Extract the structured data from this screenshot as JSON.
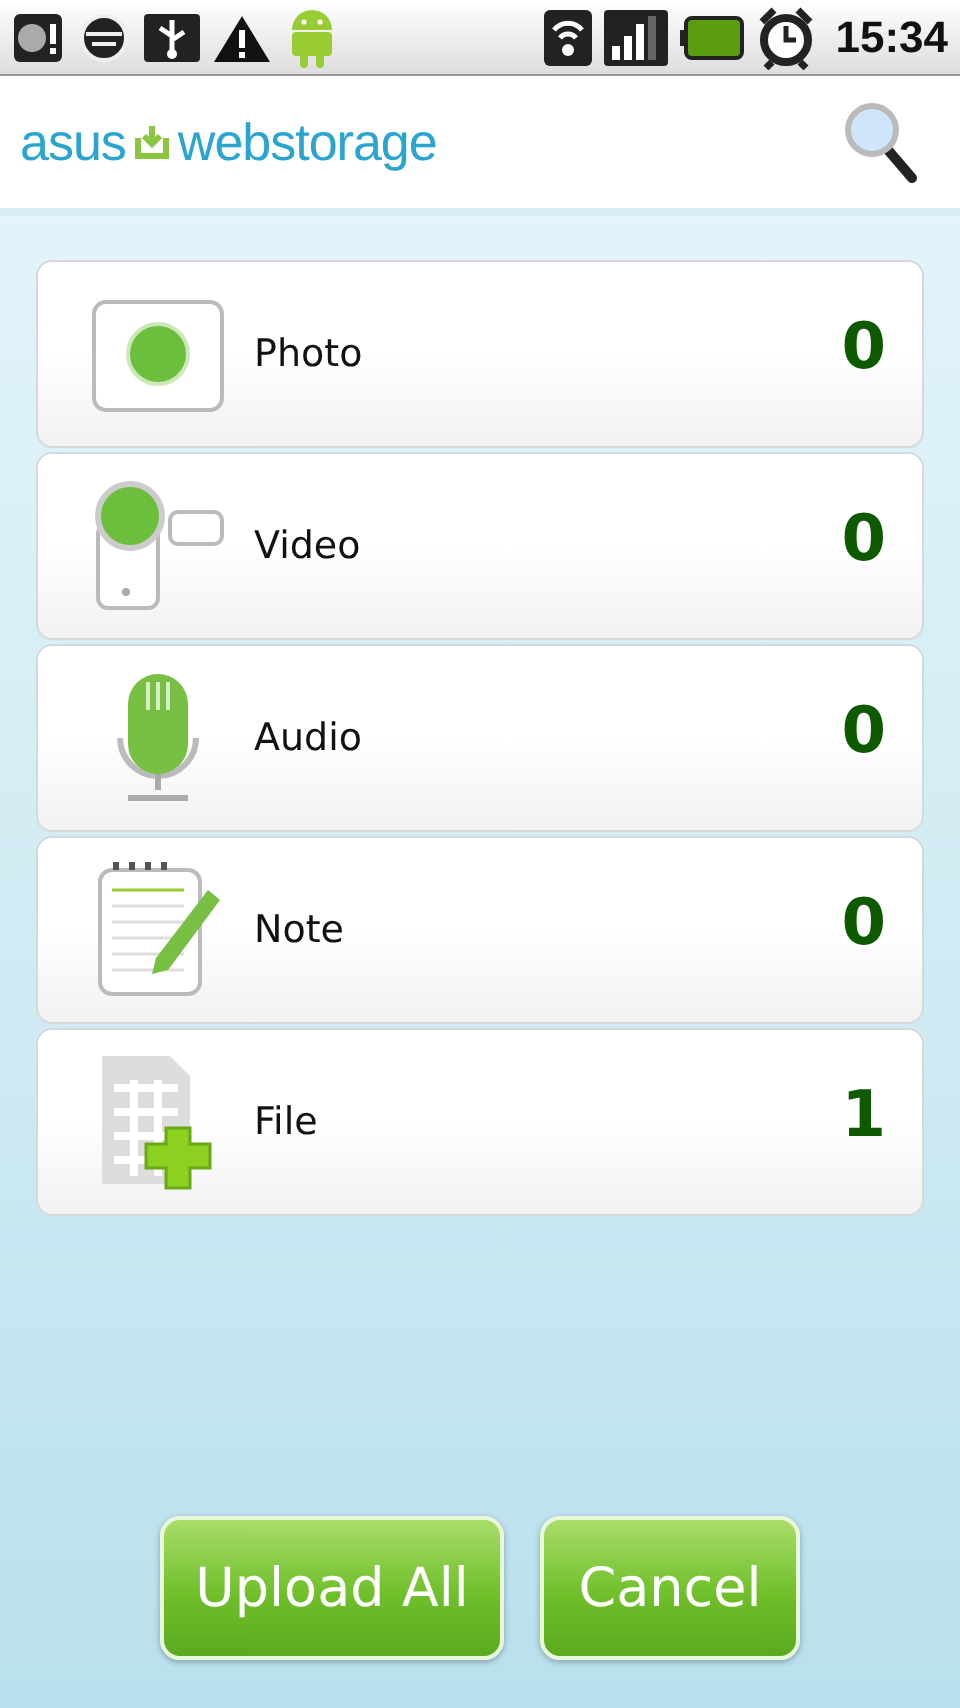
{
  "status_bar": {
    "time": "15:34"
  },
  "header": {
    "logo_left": "asus",
    "logo_right": "webstorage"
  },
  "categories": [
    {
      "kind": "photo",
      "label": "Photo",
      "count": "0"
    },
    {
      "kind": "video",
      "label": "Video",
      "count": "0"
    },
    {
      "kind": "audio",
      "label": "Audio",
      "count": "0"
    },
    {
      "kind": "note",
      "label": "Note",
      "count": "0"
    },
    {
      "kind": "file",
      "label": "File",
      "count": "1"
    }
  ],
  "buttons": [
    {
      "label": "Upload All"
    },
    {
      "label": "Cancel"
    }
  ]
}
